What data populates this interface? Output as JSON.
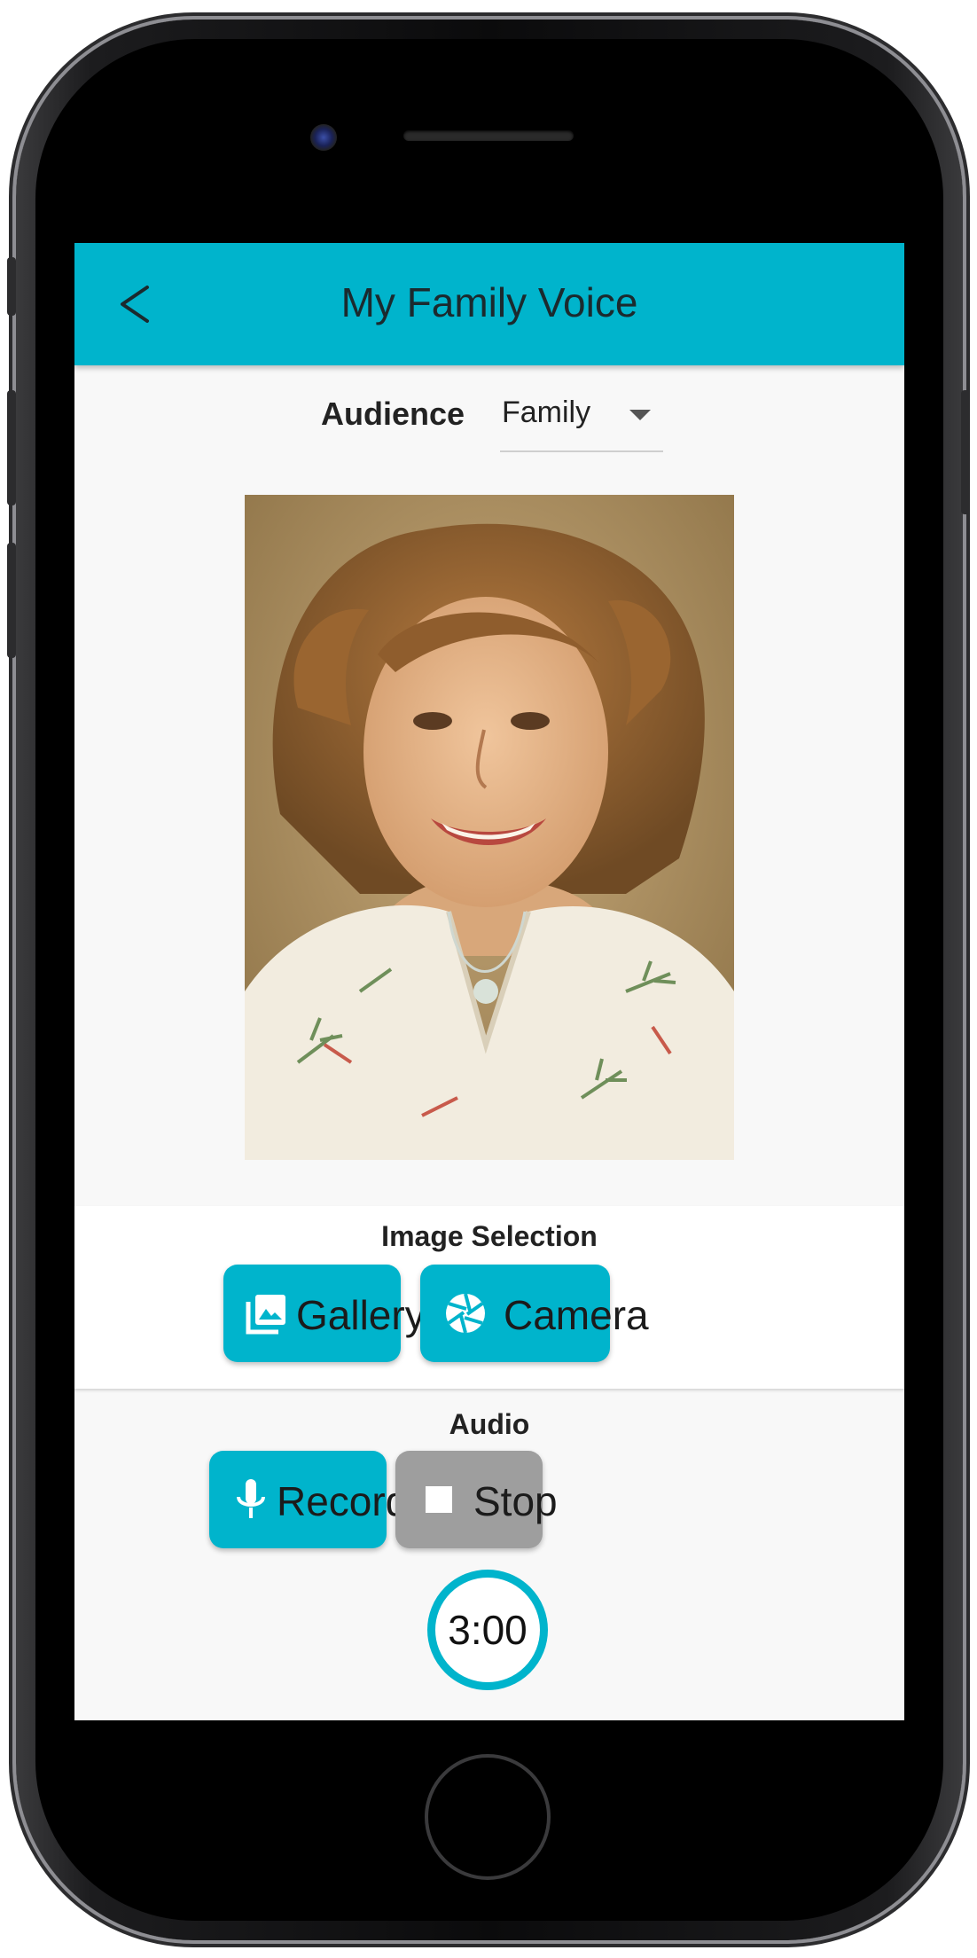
{
  "app": {
    "title": "My Family Voice"
  },
  "audience": {
    "label": "Audience",
    "value": "Family"
  },
  "photo": {
    "icon": "portrait-photo"
  },
  "image_selection": {
    "label": "Image Selection",
    "gallery_label": "Gallery",
    "camera_label": "Camera"
  },
  "audio": {
    "label": "Audio",
    "record_label": "Record",
    "stop_label": "Stop",
    "timer": "3:00"
  },
  "colors": {
    "accent": "#00b4cc",
    "disabled": "#9e9e9e",
    "background": "#f8f8f8"
  }
}
